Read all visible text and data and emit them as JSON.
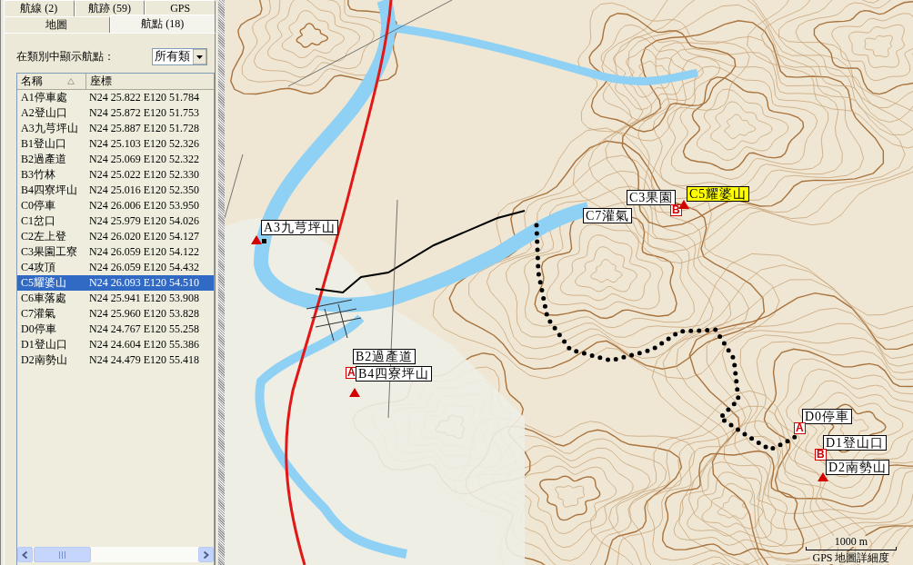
{
  "tabs_row_1": [
    {
      "label": "航線 (2)",
      "selected": false
    },
    {
      "label": "航跡 (59)",
      "selected": false
    },
    {
      "label": "GPS",
      "selected": false
    }
  ],
  "tabs_row_2": [
    {
      "label": "地圖",
      "selected": false
    },
    {
      "label": "航點 (18)",
      "selected": true
    }
  ],
  "filter": {
    "label": "在類別中顯示航點：",
    "value": "所有類"
  },
  "waypoint_list": {
    "columns": [
      "名稱",
      "座標"
    ],
    "rows": [
      {
        "name": "A1停車處",
        "coords": "N24 25.822 E120 51.784",
        "selected": false
      },
      {
        "name": "A2登山口",
        "coords": "N24 25.872 E120 51.753",
        "selected": false
      },
      {
        "name": "A3九芎坪山",
        "coords": "N24 25.887 E120 51.728",
        "selected": false
      },
      {
        "name": "B1登山口",
        "coords": "N24 25.103 E120 52.326",
        "selected": false
      },
      {
        "name": "B2過產道",
        "coords": "N24 25.069 E120 52.322",
        "selected": false
      },
      {
        "name": "B3竹林",
        "coords": "N24 25.022 E120 52.330",
        "selected": false
      },
      {
        "name": "B4四寮坪山",
        "coords": "N24 25.016 E120 52.350",
        "selected": false
      },
      {
        "name": "C0停車",
        "coords": "N24 26.006 E120 53.950",
        "selected": false
      },
      {
        "name": "C1岔口",
        "coords": "N24 25.979 E120 54.026",
        "selected": false
      },
      {
        "name": "C2左上登",
        "coords": "N24 26.020 E120 54.127",
        "selected": false
      },
      {
        "name": "C3果園工寮",
        "coords": "N24 26.059 E120 54.122",
        "selected": false
      },
      {
        "name": "C4攻頂",
        "coords": "N24 26.059 E120 54.432",
        "selected": false
      },
      {
        "name": "C5耀婆山",
        "coords": "N24 26.093 E120 54.510",
        "selected": true
      },
      {
        "name": "C6車落處",
        "coords": "N24 25.941 E120 53.908",
        "selected": false
      },
      {
        "name": "C7灌氣",
        "coords": "N24 25.960 E120 53.828",
        "selected": false
      },
      {
        "name": "D0停車",
        "coords": "N24 24.767 E120 55.258",
        "selected": false
      },
      {
        "name": "D1登山口",
        "coords": "N24 24.604 E120 55.386",
        "selected": false
      },
      {
        "name": "D2南勢山",
        "coords": "N24 24.479 E120 55.418",
        "selected": false
      }
    ]
  },
  "map": {
    "waypoints": [
      {
        "label": "A3九芎坪山",
        "peak": true,
        "selected": false
      },
      {
        "label": "B2過產道",
        "peak": false,
        "flag": "A",
        "selected": false
      },
      {
        "label": "B4四寮坪山",
        "peak": true,
        "selected": false
      },
      {
        "label": "C7灌氣",
        "peak": false,
        "selected": false
      },
      {
        "label": "C3果園",
        "peak": false,
        "flag": "B",
        "selected": false
      },
      {
        "label": "C5耀婆山",
        "peak": true,
        "selected": true
      },
      {
        "label": "D0停車",
        "peak": false,
        "flag": "A",
        "selected": false
      },
      {
        "label": "D1登山口",
        "peak": false,
        "flag": "B",
        "selected": false
      },
      {
        "label": "D2南勢山",
        "peak": true,
        "selected": false
      }
    ],
    "scale": {
      "distance": "1000 m",
      "detail_label": "GPS 地圖詳細度"
    }
  }
}
